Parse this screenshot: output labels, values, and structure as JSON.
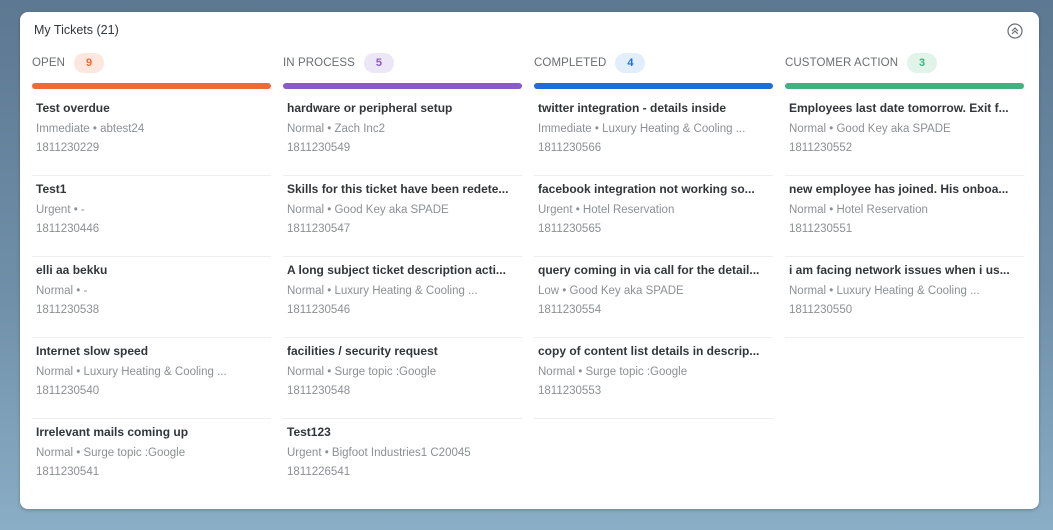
{
  "card": {
    "title": "My Tickets (21)",
    "collapse_icon": "circle-double-chevron-up-icon"
  },
  "columns": [
    {
      "key": "open",
      "label": "OPEN",
      "count": "9",
      "color": "#ed6a35",
      "badge_bg": "#fbe7de",
      "tickets": [
        {
          "title": "Test overdue",
          "meta": "Immediate • abtest24",
          "id": "1811230229"
        },
        {
          "title": "Test1",
          "meta": "Urgent • -",
          "id": "1811230446"
        },
        {
          "title": "elli aa bekku",
          "meta": "Normal • -",
          "id": "1811230538"
        },
        {
          "title": "Internet slow speed",
          "meta": "Normal • Luxury Heating & Cooling ...",
          "id": "1811230540"
        },
        {
          "title": "Irrelevant mails coming up",
          "meta": "Normal • Surge topic :Google",
          "id": "1811230541"
        }
      ]
    },
    {
      "key": "in_process",
      "label": "IN PROCESS",
      "count": "5",
      "color": "#8a5ac8",
      "badge_bg": "#ece6f7",
      "tickets": [
        {
          "title": "hardware or peripheral setup",
          "meta": "Normal • Zach Inc2",
          "id": "1811230549"
        },
        {
          "title": "Skills for this ticket have been redete...",
          "meta": "Normal • Good Key aka SPADE",
          "id": "1811230547"
        },
        {
          "title": "A long subject ticket description acti...",
          "meta": "Normal • Luxury Heating & Cooling ...",
          "id": "1811230546"
        },
        {
          "title": "facilities / security request",
          "meta": "Normal • Surge topic :Google",
          "id": "1811230548"
        },
        {
          "title": "Test123",
          "meta": "Urgent • Bigfoot Industries1 C20045",
          "id": "1811226541"
        }
      ]
    },
    {
      "key": "completed",
      "label": "COMPLETED",
      "count": "4",
      "color": "#1b6fd6",
      "badge_bg": "#e2eefb",
      "tickets": [
        {
          "title": "twitter integration - details inside",
          "meta": "Immediate • Luxury Heating & Cooling ...",
          "id": "1811230566"
        },
        {
          "title": "facebook integration not working so...",
          "meta": "Urgent • Hotel Reservation",
          "id": "1811230565"
        },
        {
          "title": "query coming in via call for the detail...",
          "meta": "Low • Good Key aka SPADE",
          "id": "1811230554"
        },
        {
          "title": "copy of content list details in descrip...",
          "meta": "Normal • Surge topic :Google",
          "id": "1811230553"
        }
      ]
    },
    {
      "key": "customer_action",
      "label": "CUSTOMER ACTION",
      "count": "3",
      "color": "#3fb27f",
      "badge_bg": "#e1f4ea",
      "tickets": [
        {
          "title": "Employees last date tomorrow. Exit f...",
          "meta": "Normal • Good Key aka SPADE",
          "id": "1811230552"
        },
        {
          "title": "new employee has joined. His onboa...",
          "meta": "Normal • Hotel Reservation",
          "id": "1811230551"
        },
        {
          "title": "i am facing network issues when i us...",
          "meta": "Normal • Luxury Heating & Cooling ...",
          "id": "1811230550"
        }
      ]
    }
  ]
}
